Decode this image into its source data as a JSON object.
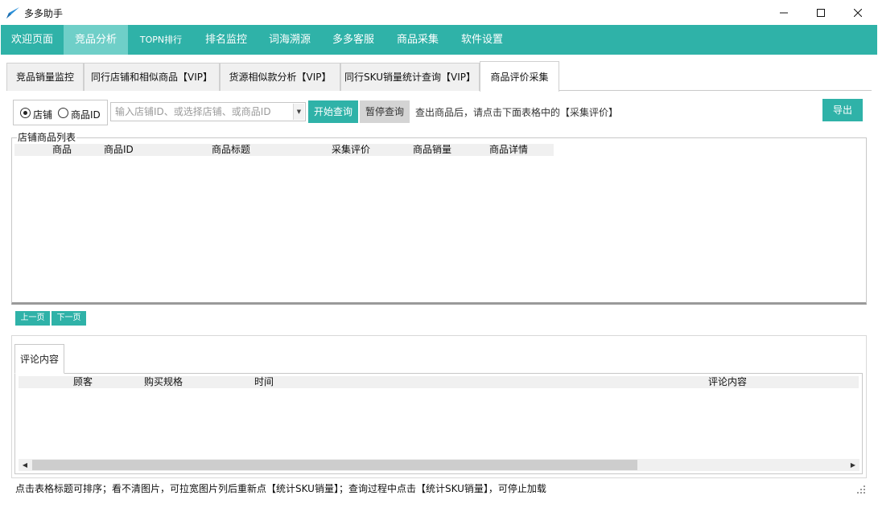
{
  "window": {
    "title": "多多助手",
    "controls": [
      "minimize-icon",
      "maximize-icon",
      "close-icon"
    ]
  },
  "menu": {
    "items": [
      {
        "label": "欢迎页面",
        "active": false
      },
      {
        "label": "竞品分析",
        "active": true
      },
      {
        "label": "TOPN排行",
        "active": false
      },
      {
        "label": "排名监控",
        "active": false
      },
      {
        "label": "词海溯源",
        "active": false
      },
      {
        "label": "多多客服",
        "active": false
      },
      {
        "label": "商品采集",
        "active": false
      },
      {
        "label": "软件设置",
        "active": false
      }
    ]
  },
  "tabs": {
    "items": [
      {
        "label": "竞品销量监控",
        "active": false
      },
      {
        "label": "同行店铺和相似商品【VIP】",
        "active": false
      },
      {
        "label": "货源相似款分析【VIP】",
        "active": false
      },
      {
        "label": "同行SKU销量统计查询【VIP】",
        "active": false
      },
      {
        "label": "商品评价采集",
        "active": true
      }
    ]
  },
  "search": {
    "mode_shop_label": "店铺",
    "mode_product_label": "商品ID",
    "selected_mode": "店铺",
    "placeholder": "输入店铺ID、或选择店铺、或商品ID",
    "value": "",
    "start_label": "开始查询",
    "pause_label": "暂停查询",
    "hint": "查出商品后，请点击下面表格中的【采集评价】",
    "export_label": "导出"
  },
  "product_list": {
    "title": "店铺商品列表",
    "columns": [
      "商品",
      "商品ID",
      "商品标题",
      "采集评价",
      "商品销量",
      "商品详情"
    ],
    "rows": []
  },
  "pager": {
    "prev_label": "上一页",
    "next_label": "下一页"
  },
  "reviews": {
    "tab_label": "评论内容",
    "columns": [
      "顾客",
      "购买规格",
      "时间",
      "评论内容"
    ],
    "rows": []
  },
  "status": {
    "text": "点击表格标题可排序；看不清图片，可拉宽图片列后重新点【统计SKU销量】；查询过程中点击【统计SKU销量】，可停止加载"
  },
  "colors": {
    "accent": "#2fb2a8",
    "menu_active": "#6fcfc8",
    "header_bg": "#f0f0f0"
  }
}
